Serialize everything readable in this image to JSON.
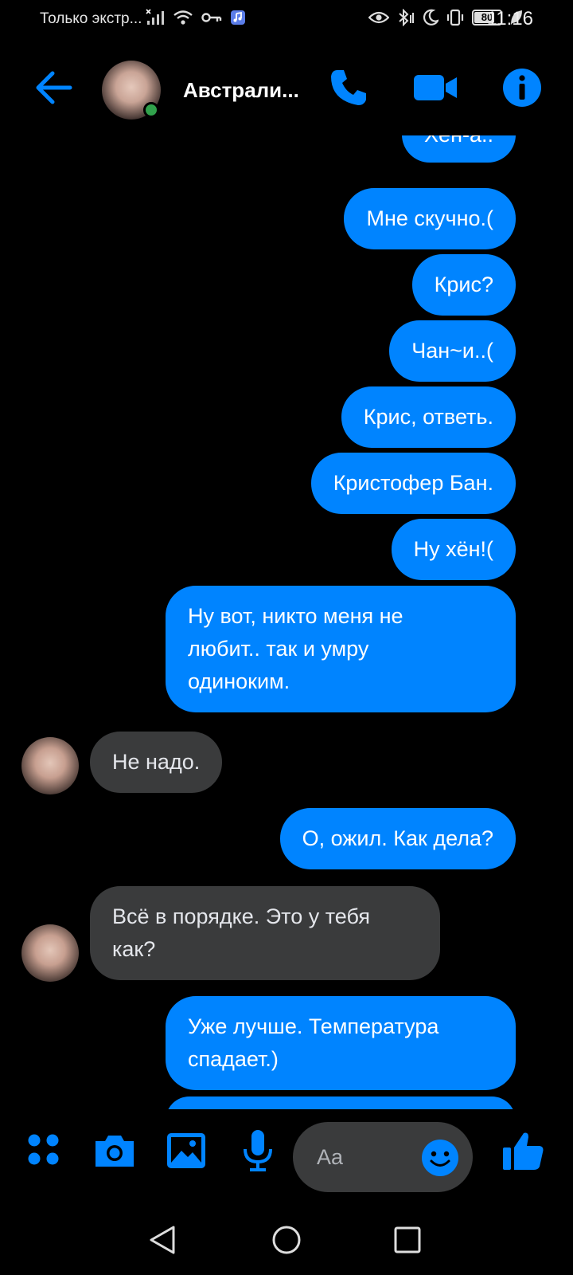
{
  "status_bar": {
    "carrier": "Только экстр...",
    "battery": "80",
    "battery_level": 0.8,
    "time": "11:16"
  },
  "header": {
    "contact_name": "Австрали...",
    "online": true
  },
  "messages": [
    {
      "dir": "out",
      "text": "Хён-а.."
    },
    {
      "dir": "out",
      "text": "Мне скучно.("
    },
    {
      "dir": "out",
      "text": "Крис?"
    },
    {
      "dir": "out",
      "text": "Чан~и..("
    },
    {
      "dir": "out",
      "text": "Крис, ответь."
    },
    {
      "dir": "out",
      "text": "Кристофер Бан."
    },
    {
      "dir": "out",
      "text": "Ну хён!("
    },
    {
      "dir": "out",
      "text": "Ну вот, никто меня не\nлюбит.. так и умру\nодиноким."
    },
    {
      "dir": "in",
      "text": "Не надо."
    },
    {
      "dir": "out",
      "text": "О, ожил. Как дела?"
    },
    {
      "dir": "in",
      "text": "Всё в порядке. Это у тебя\nкак?"
    },
    {
      "dir": "out",
      "text": "Уже лучше. Температура\nспадает.)"
    }
  ],
  "composer": {
    "placeholder": "Aa"
  },
  "colors": {
    "accent": "#0084ff",
    "incoming_bubble": "#3a3b3c",
    "background": "#000000",
    "online": "#31a24c"
  },
  "icons": {
    "header": [
      "back-arrow-icon",
      "phone-icon",
      "video-camera-icon",
      "info-icon"
    ],
    "composer": [
      "apps-menu-icon",
      "camera-icon",
      "gallery-icon",
      "microphone-icon",
      "emoji-icon",
      "thumbs-up-icon"
    ],
    "nav": [
      "nav-back-icon",
      "nav-home-icon",
      "nav-recents-icon"
    ]
  }
}
